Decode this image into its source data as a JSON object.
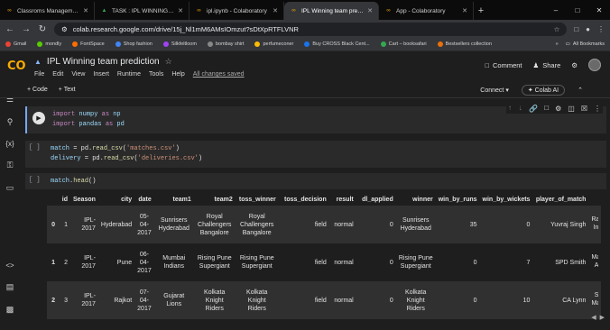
{
  "browser": {
    "tabs": [
      {
        "title": "Classroms Management Tools",
        "icon": "colab-icon",
        "active": false
      },
      {
        "title": "TASK : IPL WINNING TEAM PRE",
        "icon": "drive-icon",
        "active": false
      },
      {
        "title": "ipl.ipynb - Colaboratory",
        "icon": "colab-icon",
        "active": false
      },
      {
        "title": "IPL Winning team prediction",
        "icon": "colab-icon",
        "active": true
      },
      {
        "title": "App - Colaboratory",
        "icon": "colab-icon",
        "active": false
      }
    ],
    "new_tab": "+",
    "url": "colab.research.google.com/drive/15j_Nl1mM6AMsIOmzut?sDtXpRTFLVNR",
    "bookmarks": [
      "Gmail",
      "mondly",
      "FontSpace",
      "Shop fashion",
      "Silkfeltloom",
      "bombay shirt",
      "perfumeconer",
      "Buy CROSS Black Cent...",
      "Cart – booksafari",
      "Bestsellers collection"
    ],
    "all_bookmarks": "All Bookmarks"
  },
  "colab": {
    "logo": "CO",
    "title": "IPL Winning team prediction",
    "menus": [
      "File",
      "Edit",
      "View",
      "Insert",
      "Runtime",
      "Tools",
      "Help"
    ],
    "saved_status": "All changes saved",
    "comment": "Comment",
    "share": "Share",
    "toolbar": {
      "add_code": "+ Code",
      "add_text": "+ Text",
      "connect": "Connect",
      "colab_ai": "Colab AI"
    }
  },
  "cells": [
    {
      "exec": "",
      "lines": [
        [
          {
            "t": "import",
            "c": "kw"
          },
          {
            "t": " numpy ",
            "c": "var"
          },
          {
            "t": "as",
            "c": "kw"
          },
          {
            "t": " np",
            "c": "var"
          }
        ],
        [
          {
            "t": "import",
            "c": "kw"
          },
          {
            "t": " pandas ",
            "c": "var"
          },
          {
            "t": "as",
            "c": "kw"
          },
          {
            "t": " pd",
            "c": "var"
          }
        ]
      ]
    },
    {
      "exec": "[ ]",
      "lines": [
        [
          {
            "t": "match",
            "c": "var"
          },
          {
            "t": " = pd.",
            "c": ""
          },
          {
            "t": "read_csv",
            "c": "fn"
          },
          {
            "t": "(",
            "c": ""
          },
          {
            "t": "'matches.csv'",
            "c": "str"
          },
          {
            "t": ")",
            "c": ""
          }
        ],
        [
          {
            "t": "delivery",
            "c": "var"
          },
          {
            "t": " = pd.",
            "c": ""
          },
          {
            "t": "read_csv",
            "c": "fn"
          },
          {
            "t": "(",
            "c": ""
          },
          {
            "t": "'deliveries.csv'",
            "c": "str"
          },
          {
            "t": ")",
            "c": ""
          }
        ]
      ]
    },
    {
      "exec": "[ ]",
      "lines": [
        [
          {
            "t": "match",
            "c": "var"
          },
          {
            "t": ".",
            "c": ""
          },
          {
            "t": "head",
            "c": "fn"
          },
          {
            "t": "()",
            "c": ""
          }
        ]
      ]
    }
  ],
  "dataframe": {
    "columns": [
      "",
      "id",
      "Season",
      "city",
      "date",
      "team1",
      "team2",
      "toss_winner",
      "toss_decision",
      "result",
      "dl_applied",
      "winner",
      "win_by_runs",
      "win_by_wickets",
      "player_of_match",
      ""
    ],
    "rows": [
      [
        "0",
        "1",
        "IPL-2017",
        "Hyderabad",
        "05-04-2017",
        "Sunrisers Hyderabad",
        "Royal Challengers Bangalore",
        "Royal Challengers Bangalore",
        "field",
        "normal",
        "0",
        "Sunrisers Hyderabad",
        "35",
        "0",
        "Yuvraj Singh",
        "Ra In"
      ],
      [
        "1",
        "2",
        "IPL-2017",
        "Pune",
        "06-04-2017",
        "Mumbai Indians",
        "Rising Pune Supergiant",
        "Rising Pune Supergiant",
        "field",
        "normal",
        "0",
        "Rising Pune Supergiant",
        "0",
        "7",
        "SPD Smith",
        "Ma A"
      ],
      [
        "2",
        "3",
        "IPL-2017",
        "Rajkot",
        "07-04-2017",
        "Gujarat Lions",
        "Kolkata Knight Riders",
        "Kolkata Knight Riders",
        "field",
        "normal",
        "0",
        "Kolkata Knight Riders",
        "0",
        "10",
        "CA Lynn",
        "S Ma"
      ]
    ]
  }
}
